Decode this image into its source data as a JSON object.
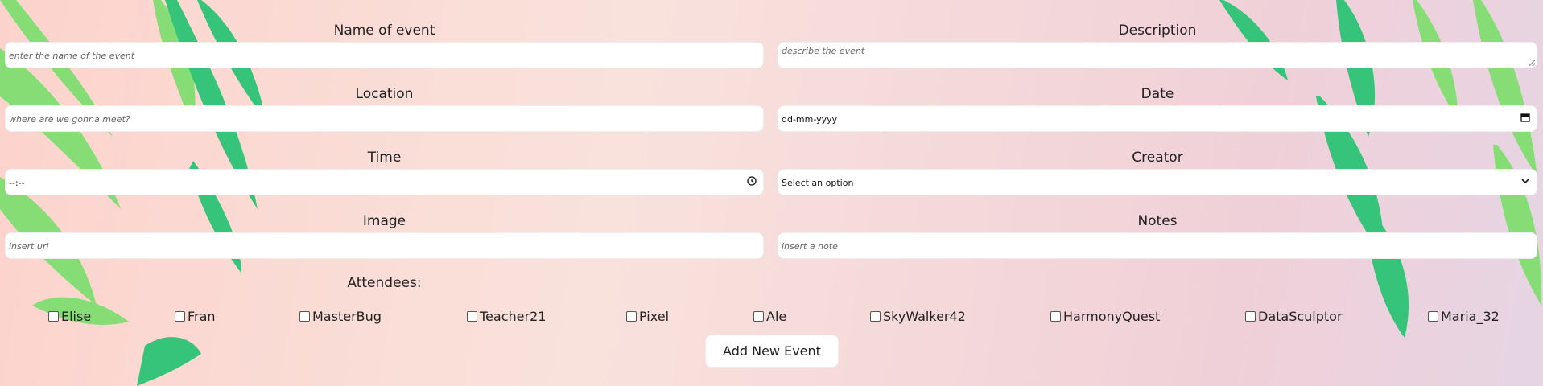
{
  "form": {
    "fields": {
      "name": {
        "label": "Name of event",
        "placeholder": "enter the name of the event"
      },
      "description": {
        "label": "Description",
        "placeholder": "describe the event"
      },
      "location": {
        "label": "Location",
        "placeholder": "where are we gonna meet?"
      },
      "date": {
        "label": "Date",
        "value": "dd-mm-yyyy"
      },
      "time": {
        "label": "Time",
        "value": "--:--"
      },
      "creator": {
        "label": "Creator",
        "value": "Select an option"
      },
      "image": {
        "label": "Image",
        "placeholder": "insert url"
      },
      "notes": {
        "label": "Notes",
        "placeholder": "insert a note"
      }
    },
    "attendees_label": "Attendees:",
    "attendees": [
      "Elise",
      "Fran",
      "MasterBug",
      "Teacher21",
      "Pixel",
      "Ale",
      "SkyWalker42",
      "HarmonyQuest",
      "DataSculptor",
      "Maria_32"
    ],
    "submit_label": "Add New Event"
  },
  "icons": {
    "calendar": "calendar-icon",
    "clock": "clock-icon",
    "chevron": "chevron-down-icon"
  },
  "colors": {
    "leaf_dark": "#35c47a",
    "leaf_light": "#86dd76",
    "background_start": "#fcd3cc",
    "background_end": "#e6d4e3"
  }
}
